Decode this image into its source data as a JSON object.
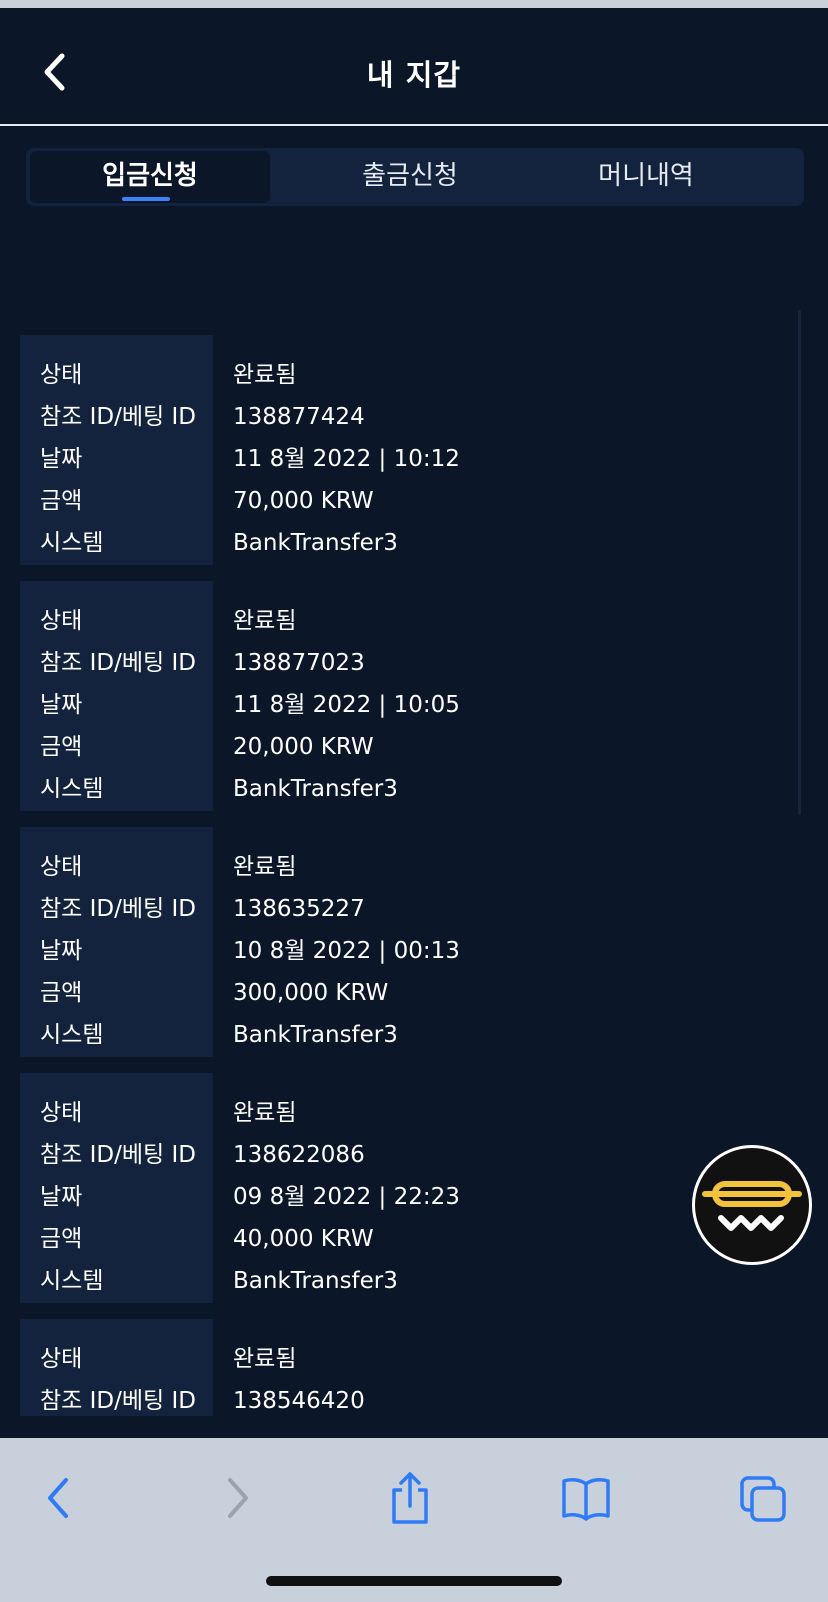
{
  "header": {
    "title": "내 지갑"
  },
  "tabs": [
    {
      "label": "입금신청",
      "active": true
    },
    {
      "label": "출금신청",
      "active": false
    },
    {
      "label": "머니내역",
      "active": false
    }
  ],
  "labels": {
    "status": "상태",
    "ref": "참조 ID/베팅 ID",
    "date": "날짜",
    "amount": "금액",
    "system": "시스템"
  },
  "transactions": [
    {
      "status": "완료됨",
      "ref": "138877424",
      "date": "11 8월 2022 | 10:12",
      "amount": "70,000 KRW",
      "system": "BankTransfer3"
    },
    {
      "status": "완료됨",
      "ref": "138877023",
      "date": "11 8월 2022 | 10:05",
      "amount": "20,000 KRW",
      "system": "BankTransfer3"
    },
    {
      "status": "완료됨",
      "ref": "138635227",
      "date": "10 8월 2022 | 00:13",
      "amount": "300,000 KRW",
      "system": "BankTransfer3"
    },
    {
      "status": "완료됨",
      "ref": "138622086",
      "date": "09 8월 2022 | 22:23",
      "amount": "40,000 KRW",
      "system": "BankTransfer3"
    },
    {
      "status": "완료됨",
      "ref": "138546420"
    }
  ],
  "colors": {
    "background": "#0b1628",
    "panel": "#13233d",
    "accent": "#3b82f6",
    "logo_yellow": "#f2c23c",
    "toolbar": "#c8d0db",
    "toolbar_icon": "#2f7bf6"
  },
  "icons": {
    "back": "chevron-left-icon",
    "logo": "hotdog-logo-icon",
    "toolbar": [
      "back-arrow-icon",
      "forward-arrow-icon",
      "share-icon",
      "bookmarks-icon",
      "tabs-icon"
    ]
  }
}
